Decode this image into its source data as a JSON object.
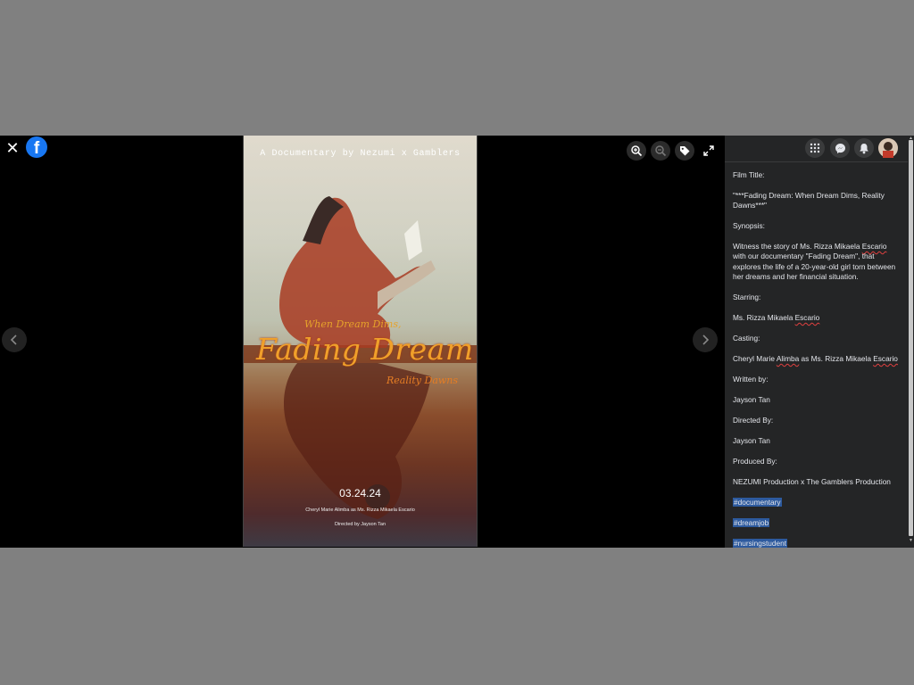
{
  "viewer": {
    "close_icon": "close-icon",
    "logo_letter": "f",
    "tools": [
      "zoom-in-icon",
      "zoom-out-icon",
      "tag-icon",
      "fullscreen-icon"
    ],
    "nav": [
      "chevron-left-icon",
      "chevron-right-icon"
    ]
  },
  "poster": {
    "tagline": "A Documentary by Nezumi x Gamblers",
    "subtitle_top": "When Dream Dims,",
    "title": "Fading Dream",
    "subtitle_bottom": "Reality Dawns",
    "date": "03.24.24",
    "cast": "Cheryl Marie Alimba as Ms. Rizza Mikaela Escario",
    "director": "Directed by Jayson Tan"
  },
  "header_icons": [
    "menu-grid-icon",
    "messenger-icon",
    "notifications-icon",
    "profile-avatar"
  ],
  "description": {
    "film_title_label": "Film Title:",
    "film_title": "\"***Fading Dream: When Dream Dims, Reality Dawns***\"",
    "synopsis_label": "Synopsis:",
    "synopsis_a": "Witness the story of Ms. Rizza Mikaela ",
    "synopsis_b": "Escario",
    "synopsis_c": " with our documentary \"Fading Dream\", that explores the life of a 20-year-old girl torn between her dreams and her financial situation.",
    "starring_label": "Starring:",
    "starring_a": "Ms. Rizza Mikaela ",
    "starring_b": "Escario",
    "casting_label": "Casting:",
    "casting_a": "Cheryl Marie ",
    "casting_b": "Alimba",
    "casting_c": " as Ms. Rizza Mikaela ",
    "casting_d": "Escario",
    "written_label": "Written by:",
    "written": "Jayson Tan",
    "directed_label": "Directed By:",
    "directed": "Jayson Tan",
    "produced_label": "Produced By:",
    "produced": "NEZUMI Production x The Gamblers Production",
    "hashtags": [
      "#documentary",
      "#dreamjob",
      "#nursingstudent"
    ]
  },
  "colors": {
    "accent": "#1877f2",
    "hashtag_bg": "#2d5a9e",
    "panel_bg": "#242526"
  }
}
